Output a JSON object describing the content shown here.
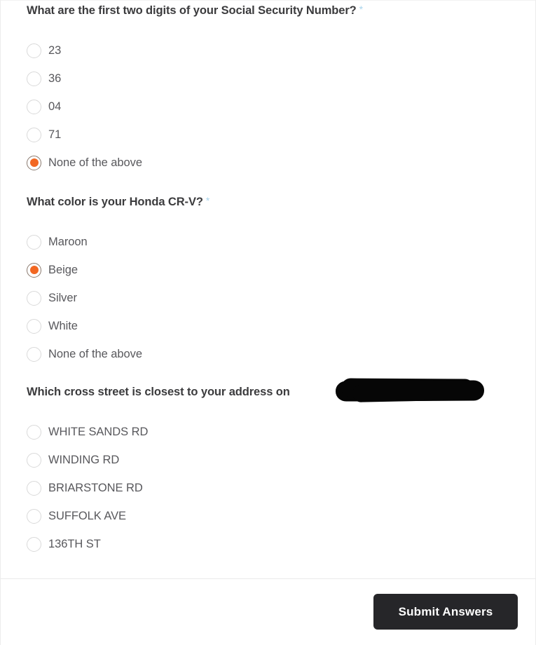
{
  "form": {
    "required_marker": "*",
    "accent_color": "#f26722",
    "required_marker_color": "#a8d4ec",
    "submit_button_color": "#262629",
    "questions": [
      {
        "id": "ssn-digits",
        "title": "What are the first two digits of your Social Security Number?",
        "required": true,
        "redacted_tail": false,
        "options": [
          {
            "label": "23",
            "selected": false
          },
          {
            "label": "36",
            "selected": false
          },
          {
            "label": "04",
            "selected": false
          },
          {
            "label": "71",
            "selected": false
          },
          {
            "label": "None of the above",
            "selected": true
          }
        ]
      },
      {
        "id": "vehicle-color",
        "title": "What color is your Honda CR-V?",
        "required": true,
        "redacted_tail": false,
        "options": [
          {
            "label": "Maroon",
            "selected": false
          },
          {
            "label": "Beige",
            "selected": true
          },
          {
            "label": "Silver",
            "selected": false
          },
          {
            "label": "White",
            "selected": false
          },
          {
            "label": "None of the above",
            "selected": false
          }
        ]
      },
      {
        "id": "cross-street",
        "title": "Which cross street is closest to your address on",
        "required": false,
        "redacted_tail": true,
        "options": [
          {
            "label": "WHITE SANDS RD",
            "selected": false
          },
          {
            "label": "WINDING RD",
            "selected": false
          },
          {
            "label": "BRIARSTONE RD",
            "selected": false
          },
          {
            "label": "SUFFOLK AVE",
            "selected": false
          },
          {
            "label": "136TH ST",
            "selected": false
          }
        ]
      }
    ]
  },
  "footer": {
    "submit_label": "Submit Answers"
  }
}
